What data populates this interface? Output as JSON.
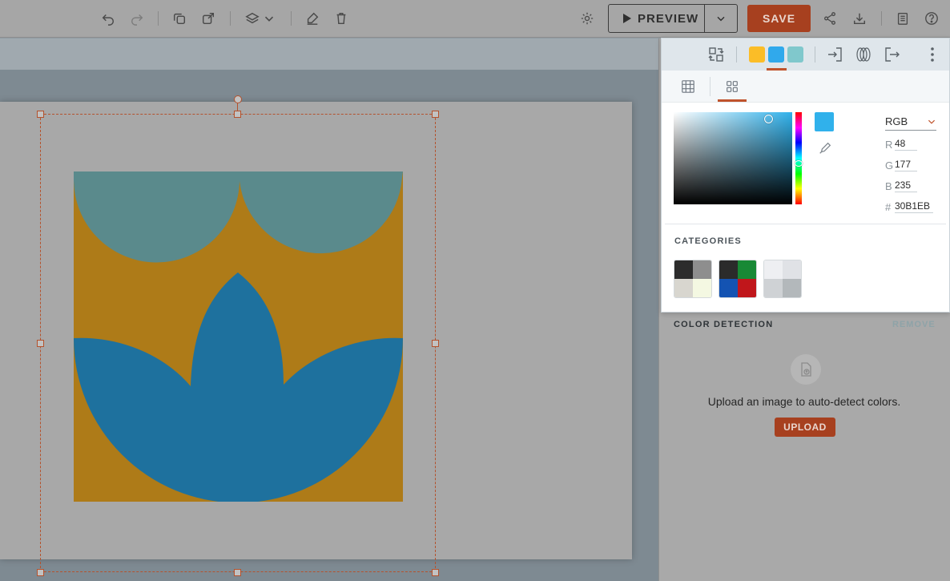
{
  "toolbar": {
    "preview_label": "PREVIEW",
    "save_label": "SAVE",
    "icons": [
      "undo-icon",
      "redo-icon",
      "duplicate-icon",
      "copy-to-icon",
      "layers-icon",
      "chevron-down-icon",
      "clear-format-icon",
      "delete-icon",
      "settings-icon",
      "play-icon",
      "share-icon",
      "download-icon",
      "notes-icon",
      "help-icon"
    ]
  },
  "canvas": {
    "artwork_colors": {
      "background": "#ae7b18",
      "top_domes": "#5a8a8c",
      "lotus": "#1e719e"
    },
    "selection_color": "#b4522d"
  },
  "color_panel": {
    "theme_swatches": [
      "#fbbd27",
      "#30a9ec",
      "#80c8cc"
    ],
    "tabs": [
      "grid-view-icon",
      "swatches-view-icon"
    ],
    "active_tab": "swatches-view-icon",
    "current_color": "#30b1eb",
    "mode": "RGB",
    "channels": [
      {
        "label": "R",
        "value": "48"
      },
      {
        "label": "G",
        "value": "177"
      },
      {
        "label": "B",
        "value": "235"
      },
      {
        "label": "#",
        "value": "30B1EB"
      }
    ],
    "categories_title": "CATEGORIES",
    "palettes": [
      [
        "#2c2c2c",
        "#8e8e8e",
        "#d8d6cf",
        "#f4f8e2"
      ],
      [
        "#2b2b2b",
        "#188935",
        "#1453b2",
        "#c0161b"
      ],
      [
        "#eeeff2",
        "#e0e2e6",
        "#cfd2d5",
        "#b3b8bb"
      ]
    ]
  },
  "color_detection": {
    "title": "COLOR DETECTION",
    "remove_label": "REMOVE",
    "message": "Upload an image to auto-detect colors.",
    "upload_label": "UPLOAD"
  }
}
